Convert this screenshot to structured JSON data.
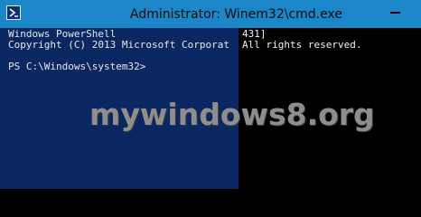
{
  "window": {
    "title": "Administrator: Winem32\\cmd.exe",
    "icon": "powershell-icon",
    "titlebar_color": "#1c87c8"
  },
  "console": {
    "background_left": "#0b2761",
    "background_right": "#000000",
    "line1_left": "Windows PowerShell",
    "line1_right": "431]",
    "line2_left": "Copyright (C) 2013 Microsoft Corporat",
    "line2_right": "All rights reserved.",
    "prompt": "PS C:\\Windows\\system32>"
  },
  "watermark": {
    "text": "mywindows8.org"
  }
}
